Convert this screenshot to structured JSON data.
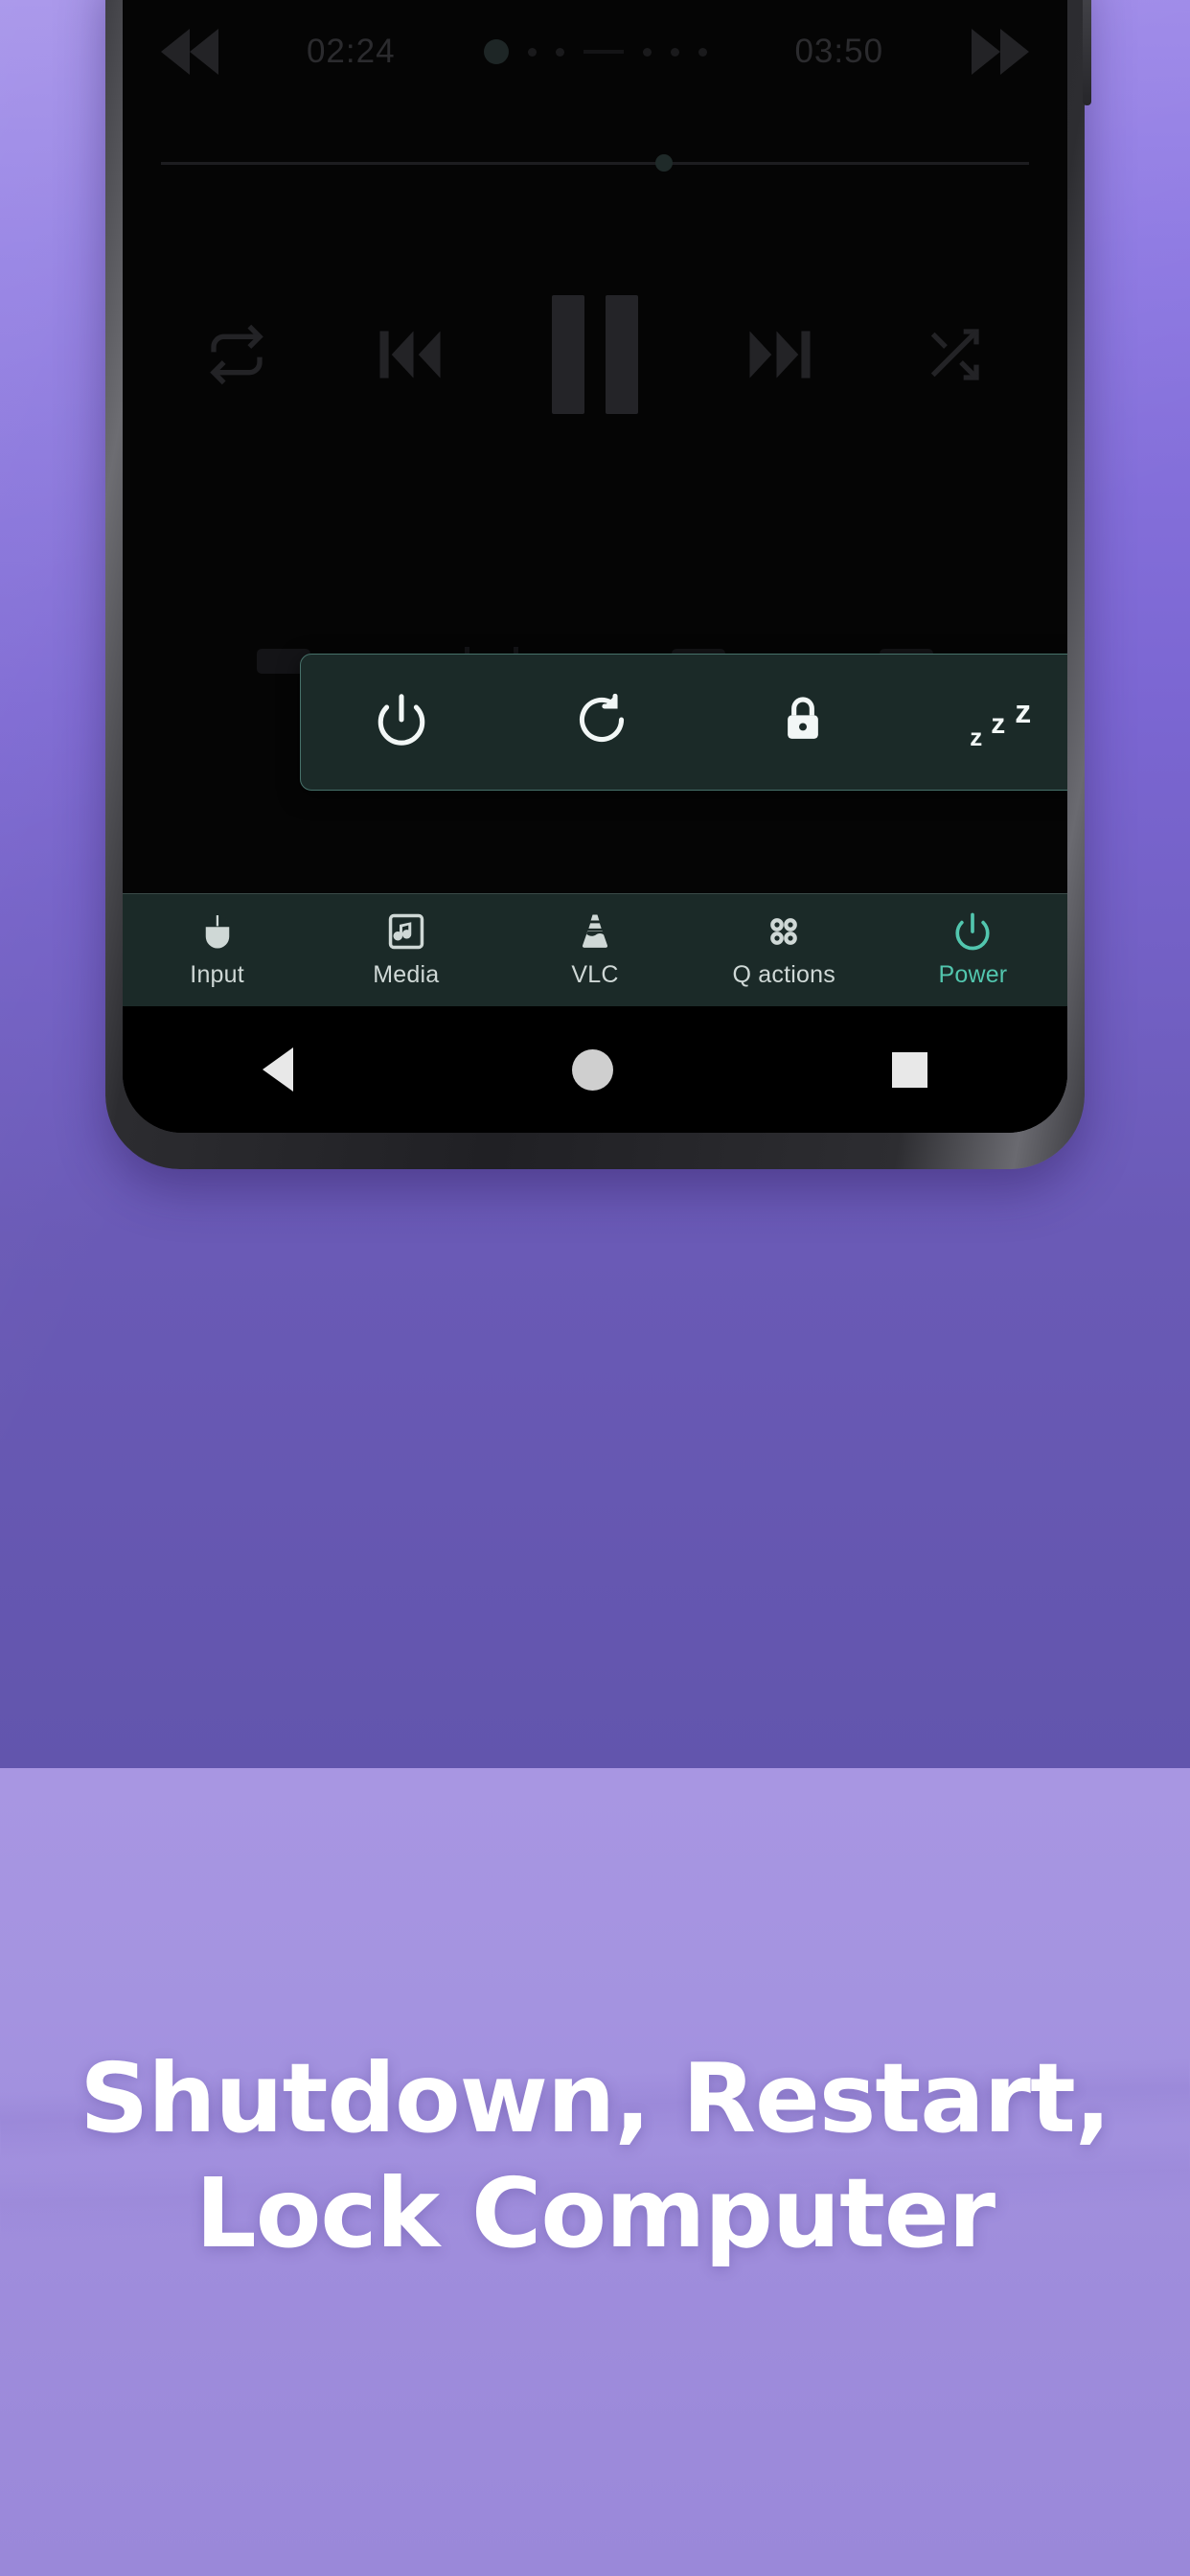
{
  "background": {
    "top_color": "#7b66d2",
    "bottom_color": "#a493e0"
  },
  "phone": {
    "app": {
      "media": {
        "rewind_icon": "rewind-icon",
        "elapsed_time": "02:24",
        "total_time": "03:50",
        "forward_icon": "fast-forward-icon",
        "repeat_icon": "repeat-icon",
        "previous_icon": "previous-track-icon",
        "pause_icon": "pause-icon",
        "next_icon": "next-track-icon",
        "shuffle_icon": "shuffle-icon"
      },
      "power_popup": {
        "items": [
          {
            "name": "shutdown",
            "icon": "power-icon",
            "label": ""
          },
          {
            "name": "restart",
            "icon": "restart-icon",
            "label": ""
          },
          {
            "name": "lock",
            "icon": "lock-icon",
            "label": ""
          },
          {
            "name": "sleep",
            "icon": "sleep-zzz-icon",
            "z1": "z",
            "z2": "z",
            "z3": "z"
          }
        ]
      },
      "tabs": [
        {
          "label": "Input",
          "icon": "mouse-icon",
          "active": false
        },
        {
          "label": "Media",
          "icon": "music-note-icon",
          "active": false
        },
        {
          "label": "VLC",
          "icon": "vlc-cone-icon",
          "active": false
        },
        {
          "label": "Q actions",
          "icon": "grid-dots-icon",
          "active": false
        },
        {
          "label": "Power",
          "icon": "power-icon",
          "active": true
        }
      ],
      "accent_color": "#52c6ae",
      "surface_color": "#1b2a28"
    },
    "navigation_bar": {
      "back_icon": "back-triangle-icon",
      "home_icon": "home-circle-icon",
      "recents_icon": "recents-square-icon"
    }
  },
  "headline": {
    "line1": "Shutdown, Restart,",
    "line2": "Lock Computer"
  }
}
